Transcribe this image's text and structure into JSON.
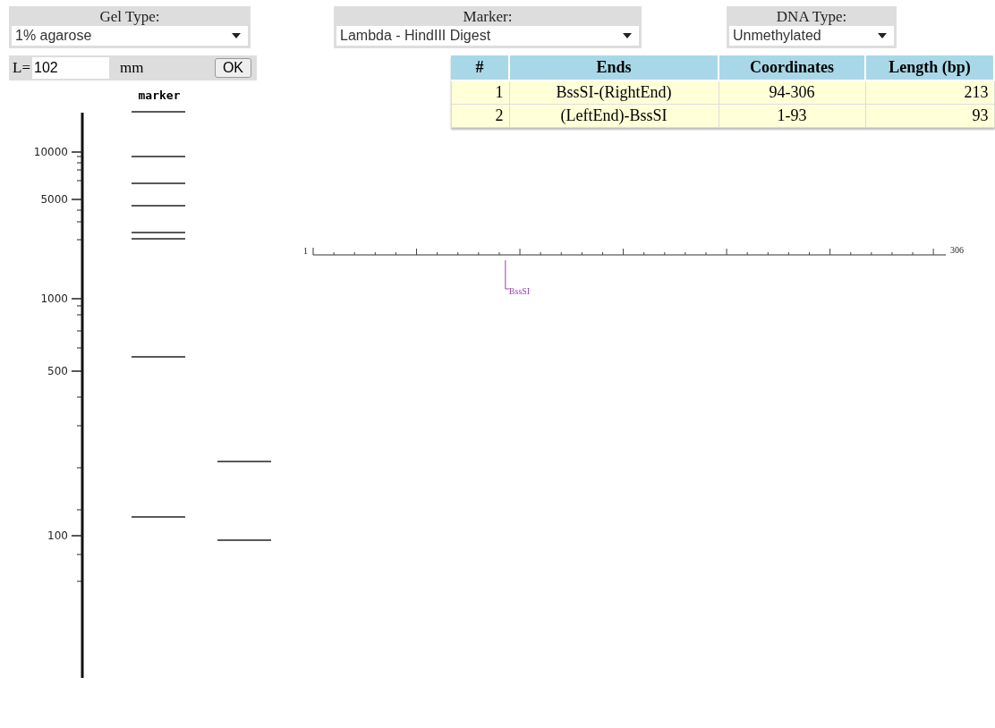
{
  "selectors": [
    {
      "label": "Gel Type:",
      "value": "1% agarose"
    },
    {
      "label": "Marker:",
      "value": "Lambda - HindIII Digest"
    },
    {
      "label": "DNA Type:",
      "value": "Unmethylated"
    }
  ],
  "length_field": {
    "label": "L=",
    "value": "102",
    "unit": "mm",
    "button": "OK"
  },
  "table": {
    "columns": [
      "#",
      "Ends",
      "Coordinates",
      "Length (bp)"
    ],
    "rows": [
      {
        "cells": [
          "1",
          "BssSI-(RightEnd)",
          "94-306",
          "213"
        ]
      },
      {
        "cells": [
          "2",
          "(LeftEnd)-BssSI",
          "1-93",
          "93"
        ]
      }
    ]
  },
  "gel": {
    "lane_label": "marker",
    "axis_labels": [
      "10000",
      "5000",
      "1000",
      "500",
      "100"
    ]
  },
  "map": {
    "start": "1",
    "end": "306",
    "sites": [
      {
        "label": "BssSI"
      }
    ]
  }
}
